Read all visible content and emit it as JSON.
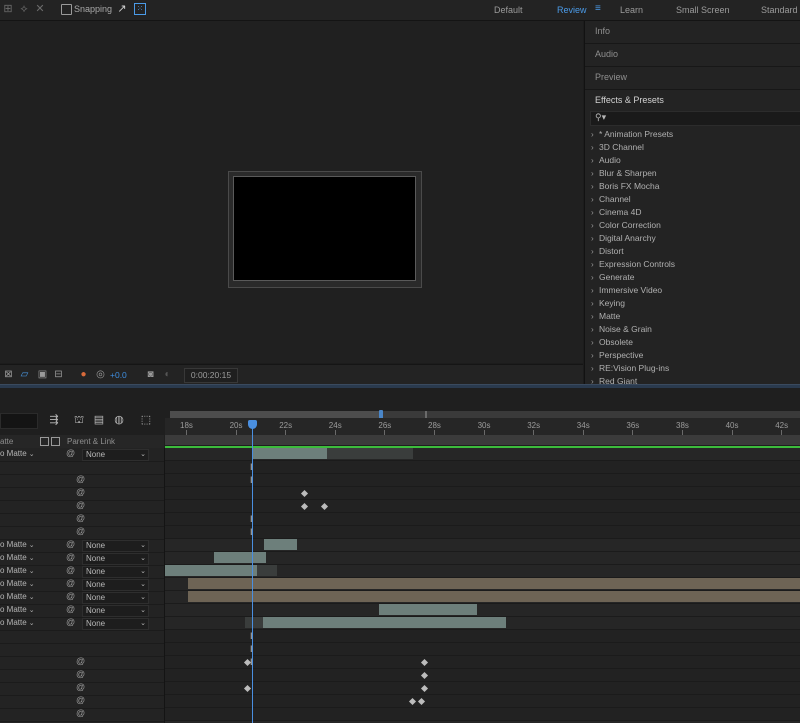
{
  "toolbar": {
    "snapping_label": "Snapping",
    "workspaces": [
      "Default",
      "Review",
      "Learn",
      "Small Screen",
      "Standard"
    ],
    "active_workspace": "Review",
    "accent_color": "#4b9be8"
  },
  "viewer_bar": {
    "exposure": "+0.0",
    "timecode": "0:00:20:15"
  },
  "panels": {
    "tabs": [
      "Info",
      "Audio",
      "Preview",
      "Effects & Presets"
    ],
    "active_tab": "Effects & Presets",
    "search_icon": "search-icon",
    "effects": [
      "* Animation Presets",
      "3D Channel",
      "Audio",
      "Blur & Sharpen",
      "Boris FX Mocha",
      "Channel",
      "Cinema 4D",
      "Color Correction",
      "Digital Anarchy",
      "Distort",
      "Expression Controls",
      "Generate",
      "Immersive Video",
      "Keying",
      "Matte",
      "Noise & Grain",
      "Obsolete",
      "Perspective",
      "RE:Vision Plug-ins",
      "Red Giant"
    ]
  },
  "timeline": {
    "header": {
      "matte_col": "atte",
      "parent_col": "Parent & Link"
    },
    "ruler_labels": [
      "18s",
      "20s",
      "22s",
      "24s",
      "26s",
      "28s",
      "30s",
      "32s",
      "34s",
      "36s",
      "38s",
      "40s",
      "42s"
    ],
    "layers": [
      {
        "matte": "o Matte",
        "parent": "None"
      },
      {
        "matte": "o Matte",
        "parent": "None"
      },
      {
        "matte": "o Matte",
        "parent": "None"
      },
      {
        "matte": "o Matte",
        "parent": "None"
      },
      {
        "matte": "o Matte",
        "parent": "None"
      },
      {
        "matte": "o Matte",
        "parent": "None"
      },
      {
        "matte": "o Matte",
        "parent": "None"
      },
      {
        "matte": "o Matte",
        "parent": "None"
      }
    ],
    "bar_colors": {
      "gray": "#6d7f7b",
      "tan": "#6e6455",
      "dark": "#3a3d3c"
    }
  }
}
